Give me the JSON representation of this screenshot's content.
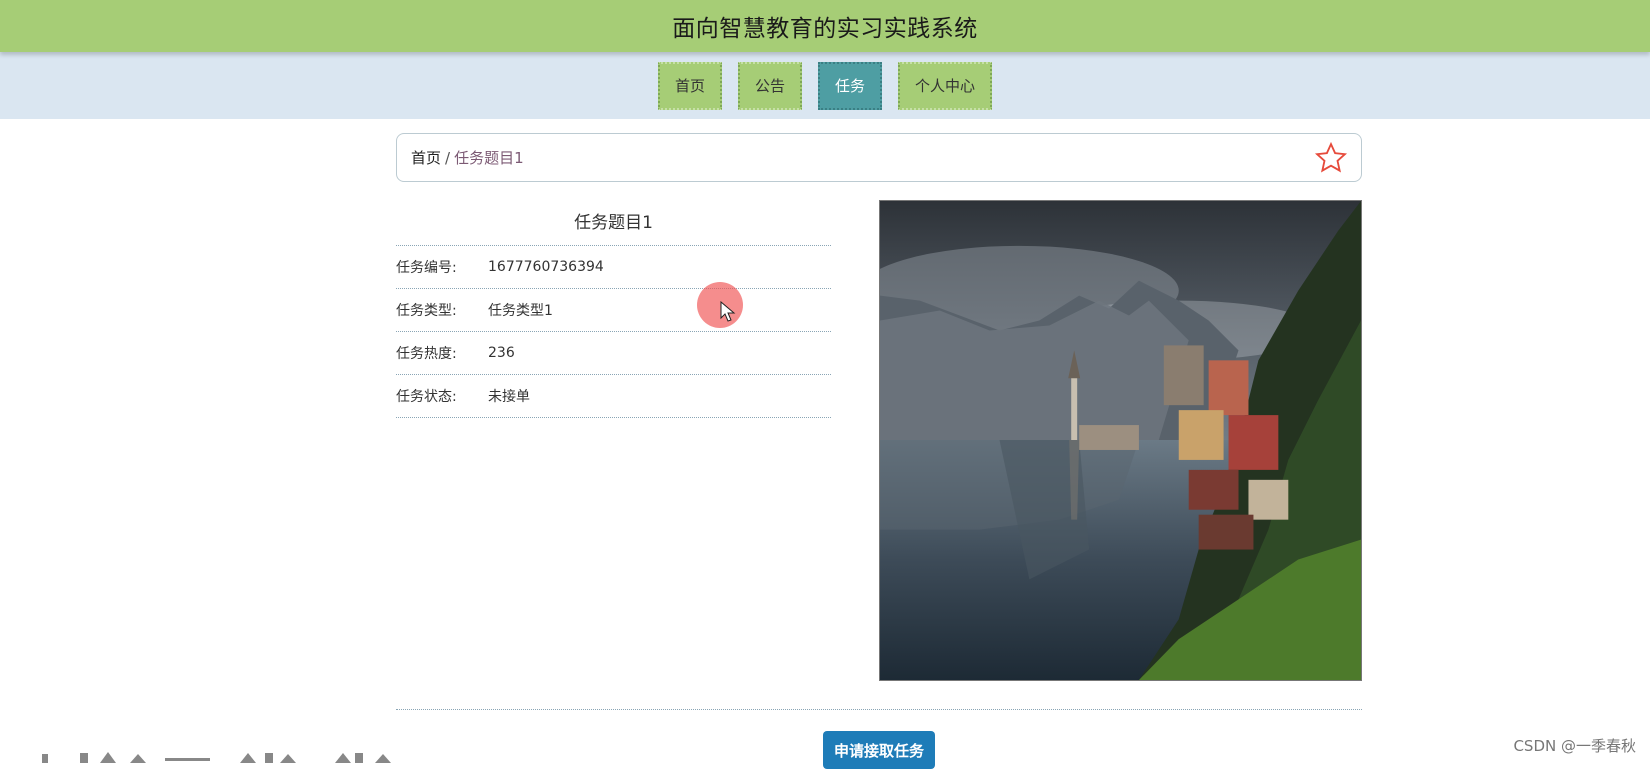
{
  "header": {
    "title": "面向智慧教育的实习实践系统"
  },
  "nav": {
    "items": [
      {
        "label": "首页",
        "active": false
      },
      {
        "label": "公告",
        "active": false
      },
      {
        "label": "任务",
        "active": true
      },
      {
        "label": "个人中心",
        "active": false
      }
    ]
  },
  "breadcrumb": {
    "home": "首页",
    "separator": "/",
    "current": "任务题目1"
  },
  "favorite": {
    "icon": "star-outline-icon",
    "color": "#e64a3b"
  },
  "task": {
    "title": "任务题目1",
    "fields": [
      {
        "label": "任务编号:",
        "value": "1677760736394"
      },
      {
        "label": "任务类型:",
        "value": "任务类型1"
      },
      {
        "label": "任务热度:",
        "value": "236"
      },
      {
        "label": "任务状态:",
        "value": "未接单"
      }
    ]
  },
  "actions": {
    "apply_label": "申请接取任务"
  },
  "watermark": "CSDN @一季春秋",
  "colors": {
    "header_bg": "#a6cd76",
    "nav_bg": "#dae6f1",
    "nav_active": "#4e9ea3",
    "button_bg": "#1e7cb8"
  }
}
